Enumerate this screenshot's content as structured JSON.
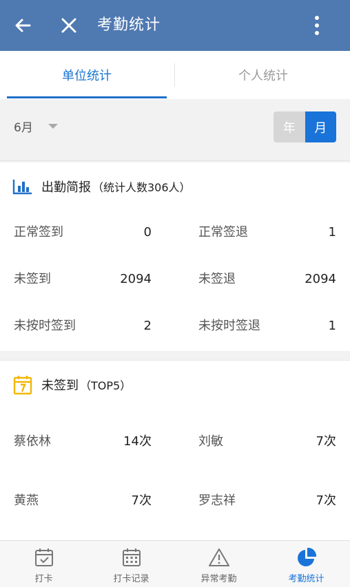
{
  "header": {
    "title": "考勤统计",
    "back_icon": "arrow-left-icon",
    "close_icon": "close-icon",
    "more_icon": "more-vertical-icon"
  },
  "tabs": [
    {
      "label": "单位统计",
      "active": true
    },
    {
      "label": "个人统计",
      "active": false
    }
  ],
  "filter": {
    "month": "6月",
    "segment": [
      {
        "label": "年",
        "active": false
      },
      {
        "label": "月",
        "active": true
      }
    ]
  },
  "summary": {
    "icon": "bar-chart-icon",
    "title": "出勤简报",
    "subtitle": "（统计人数306人）",
    "stats": [
      {
        "label": "正常签到",
        "value": "0"
      },
      {
        "label": "正常签退",
        "value": "1"
      },
      {
        "label": "未签到",
        "value": "2094"
      },
      {
        "label": "未签退",
        "value": "2094"
      },
      {
        "label": "未按时签到",
        "value": "2"
      },
      {
        "label": "未按时签退",
        "value": "1"
      }
    ]
  },
  "unsigned": {
    "icon": "calendar-icon",
    "title": "未签到",
    "subtitle": "（TOP5）",
    "rows": [
      {
        "name": "蔡依林",
        "count": "14次"
      },
      {
        "name": "刘敏",
        "count": "7次"
      },
      {
        "name": "黄燕",
        "count": "7次"
      },
      {
        "name": "罗志祥",
        "count": "7次"
      }
    ]
  },
  "bottom_nav": [
    {
      "label": "打卡",
      "icon": "calendar-check-icon",
      "active": false
    },
    {
      "label": "打卡记录",
      "icon": "calendar-grid-icon",
      "active": false
    },
    {
      "label": "异常考勤",
      "icon": "warning-icon",
      "active": false
    },
    {
      "label": "考勤统计",
      "icon": "pie-chart-icon",
      "active": true
    }
  ],
  "colors": {
    "header": "#4f79b1",
    "accent": "#1a73d9",
    "summary_icon": "#1f6fc9",
    "calendar_icon": "#f2b705"
  }
}
